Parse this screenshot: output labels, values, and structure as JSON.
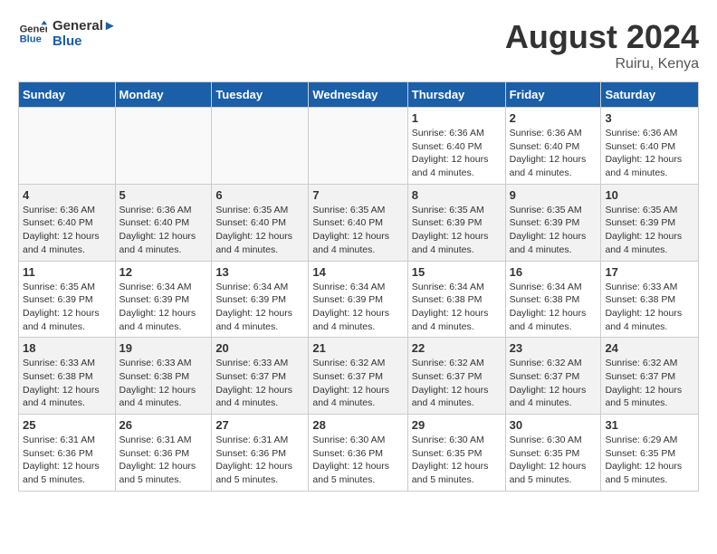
{
  "logo": {
    "line1": "General",
    "line2": "Blue"
  },
  "title": "August 2024",
  "location": "Ruiru, Kenya",
  "headers": [
    "Sunday",
    "Monday",
    "Tuesday",
    "Wednesday",
    "Thursday",
    "Friday",
    "Saturday"
  ],
  "weeks": [
    [
      {
        "num": "",
        "info": "",
        "empty": true
      },
      {
        "num": "",
        "info": "",
        "empty": true
      },
      {
        "num": "",
        "info": "",
        "empty": true
      },
      {
        "num": "",
        "info": "",
        "empty": true
      },
      {
        "num": "1",
        "info": "Sunrise: 6:36 AM\nSunset: 6:40 PM\nDaylight: 12 hours\nand 4 minutes."
      },
      {
        "num": "2",
        "info": "Sunrise: 6:36 AM\nSunset: 6:40 PM\nDaylight: 12 hours\nand 4 minutes."
      },
      {
        "num": "3",
        "info": "Sunrise: 6:36 AM\nSunset: 6:40 PM\nDaylight: 12 hours\nand 4 minutes."
      }
    ],
    [
      {
        "num": "4",
        "info": "Sunrise: 6:36 AM\nSunset: 6:40 PM\nDaylight: 12 hours\nand 4 minutes."
      },
      {
        "num": "5",
        "info": "Sunrise: 6:36 AM\nSunset: 6:40 PM\nDaylight: 12 hours\nand 4 minutes."
      },
      {
        "num": "6",
        "info": "Sunrise: 6:35 AM\nSunset: 6:40 PM\nDaylight: 12 hours\nand 4 minutes."
      },
      {
        "num": "7",
        "info": "Sunrise: 6:35 AM\nSunset: 6:40 PM\nDaylight: 12 hours\nand 4 minutes."
      },
      {
        "num": "8",
        "info": "Sunrise: 6:35 AM\nSunset: 6:39 PM\nDaylight: 12 hours\nand 4 minutes."
      },
      {
        "num": "9",
        "info": "Sunrise: 6:35 AM\nSunset: 6:39 PM\nDaylight: 12 hours\nand 4 minutes."
      },
      {
        "num": "10",
        "info": "Sunrise: 6:35 AM\nSunset: 6:39 PM\nDaylight: 12 hours\nand 4 minutes."
      }
    ],
    [
      {
        "num": "11",
        "info": "Sunrise: 6:35 AM\nSunset: 6:39 PM\nDaylight: 12 hours\nand 4 minutes."
      },
      {
        "num": "12",
        "info": "Sunrise: 6:34 AM\nSunset: 6:39 PM\nDaylight: 12 hours\nand 4 minutes."
      },
      {
        "num": "13",
        "info": "Sunrise: 6:34 AM\nSunset: 6:39 PM\nDaylight: 12 hours\nand 4 minutes."
      },
      {
        "num": "14",
        "info": "Sunrise: 6:34 AM\nSunset: 6:39 PM\nDaylight: 12 hours\nand 4 minutes."
      },
      {
        "num": "15",
        "info": "Sunrise: 6:34 AM\nSunset: 6:38 PM\nDaylight: 12 hours\nand 4 minutes."
      },
      {
        "num": "16",
        "info": "Sunrise: 6:34 AM\nSunset: 6:38 PM\nDaylight: 12 hours\nand 4 minutes."
      },
      {
        "num": "17",
        "info": "Sunrise: 6:33 AM\nSunset: 6:38 PM\nDaylight: 12 hours\nand 4 minutes."
      }
    ],
    [
      {
        "num": "18",
        "info": "Sunrise: 6:33 AM\nSunset: 6:38 PM\nDaylight: 12 hours\nand 4 minutes."
      },
      {
        "num": "19",
        "info": "Sunrise: 6:33 AM\nSunset: 6:38 PM\nDaylight: 12 hours\nand 4 minutes."
      },
      {
        "num": "20",
        "info": "Sunrise: 6:33 AM\nSunset: 6:37 PM\nDaylight: 12 hours\nand 4 minutes."
      },
      {
        "num": "21",
        "info": "Sunrise: 6:32 AM\nSunset: 6:37 PM\nDaylight: 12 hours\nand 4 minutes."
      },
      {
        "num": "22",
        "info": "Sunrise: 6:32 AM\nSunset: 6:37 PM\nDaylight: 12 hours\nand 4 minutes."
      },
      {
        "num": "23",
        "info": "Sunrise: 6:32 AM\nSunset: 6:37 PM\nDaylight: 12 hours\nand 4 minutes."
      },
      {
        "num": "24",
        "info": "Sunrise: 6:32 AM\nSunset: 6:37 PM\nDaylight: 12 hours\nand 5 minutes."
      }
    ],
    [
      {
        "num": "25",
        "info": "Sunrise: 6:31 AM\nSunset: 6:36 PM\nDaylight: 12 hours\nand 5 minutes."
      },
      {
        "num": "26",
        "info": "Sunrise: 6:31 AM\nSunset: 6:36 PM\nDaylight: 12 hours\nand 5 minutes."
      },
      {
        "num": "27",
        "info": "Sunrise: 6:31 AM\nSunset: 6:36 PM\nDaylight: 12 hours\nand 5 minutes."
      },
      {
        "num": "28",
        "info": "Sunrise: 6:30 AM\nSunset: 6:36 PM\nDaylight: 12 hours\nand 5 minutes."
      },
      {
        "num": "29",
        "info": "Sunrise: 6:30 AM\nSunset: 6:35 PM\nDaylight: 12 hours\nand 5 minutes."
      },
      {
        "num": "30",
        "info": "Sunrise: 6:30 AM\nSunset: 6:35 PM\nDaylight: 12 hours\nand 5 minutes."
      },
      {
        "num": "31",
        "info": "Sunrise: 6:29 AM\nSunset: 6:35 PM\nDaylight: 12 hours\nand 5 minutes."
      }
    ]
  ]
}
